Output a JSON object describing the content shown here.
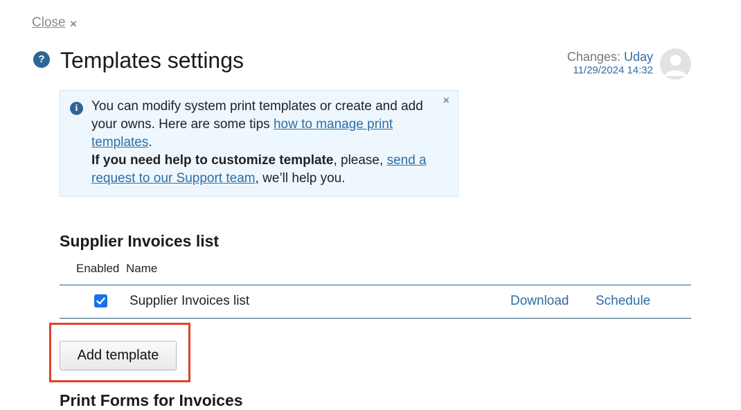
{
  "header": {
    "close_label": "Close",
    "close_icon": "×",
    "help_icon": "?",
    "title": "Templates settings",
    "changes_label": "Changes:",
    "changes_user": "Uday",
    "changes_date": "11/29/2024 14:32"
  },
  "info": {
    "icon": "i",
    "close_icon": "×",
    "line1_text": "You can modify system print templates or create and add your owns. Here are some tips ",
    "line1_link": "how to manage print templates",
    "line1_end": ".",
    "line2_bold": "If you need help to customize template",
    "line2_text": ", please, ",
    "line2_link": "send a request to our Support team",
    "line2_end": ", we’ll help you."
  },
  "section": {
    "title": "Supplier Invoices list",
    "columns": {
      "enabled": "Enabled",
      "name": "Name"
    },
    "rows": [
      {
        "enabled": true,
        "name": "Supplier Invoices list",
        "download": "Download",
        "schedule": "Schedule"
      }
    ],
    "add_button": "Add template"
  },
  "next_section": {
    "title": "Print Forms for Invoices"
  }
}
